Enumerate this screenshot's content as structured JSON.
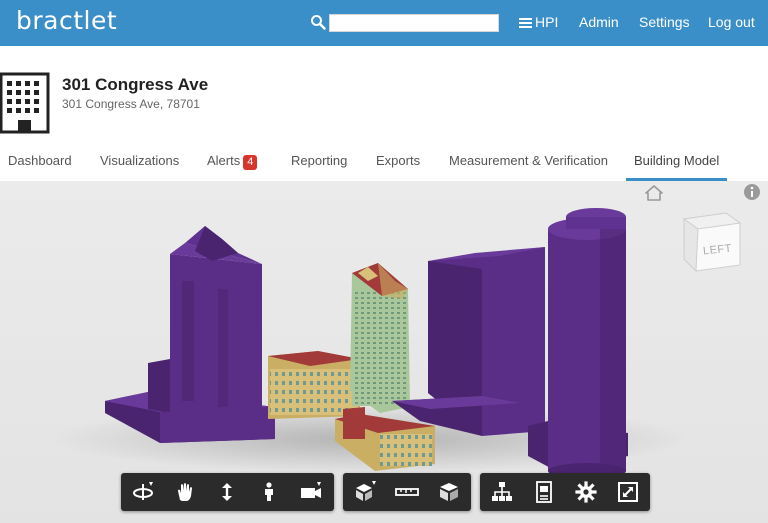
{
  "app": {
    "logo": "bractlet"
  },
  "search": {
    "placeholder": "",
    "value": ""
  },
  "nav": {
    "hpi": "HPI",
    "admin": "Admin",
    "settings": "Settings",
    "logout": "Log out"
  },
  "building": {
    "name": "301 Congress Ave",
    "address": "301 Congress Ave, 78701"
  },
  "tabs": [
    {
      "label": "Dashboard"
    },
    {
      "label": "Visualizations"
    },
    {
      "label": "Alerts",
      "badge": "4"
    },
    {
      "label": "Reporting"
    },
    {
      "label": "Exports"
    },
    {
      "label": "Measurement & Verification"
    },
    {
      "label": "Building Model",
      "active": true
    }
  ],
  "viewer": {
    "viewcube_face": "LEFT",
    "toolbar": {
      "navigation": [
        "orbit-icon",
        "pan-icon",
        "zoom-icon",
        "first-person-icon",
        "camera-icon"
      ],
      "inspection": [
        "explode-icon",
        "measure-icon",
        "section-icon"
      ],
      "model": [
        "model-browser-icon",
        "properties-icon",
        "settings-icon",
        "fullscreen-icon"
      ]
    }
  },
  "colors": {
    "header_bg": "#3b8fc9",
    "accent": "#3b8fc9",
    "badge": "#d9342b",
    "building_purple": "#5a2d86",
    "roof_red": "#a23a3a",
    "wall_tan": "#d8c07a",
    "glass_green": "#a9c79a",
    "toolbar_bg": "#2b2b2b"
  }
}
